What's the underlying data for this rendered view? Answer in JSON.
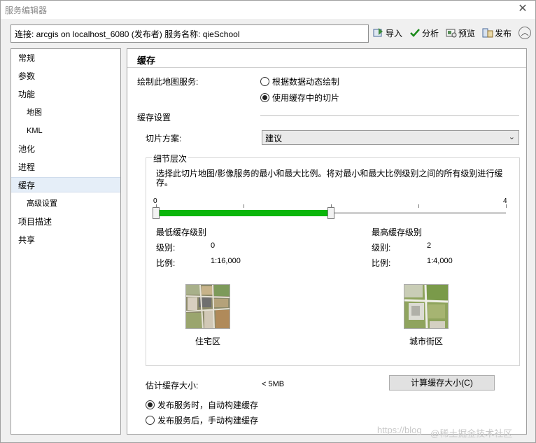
{
  "window": {
    "title": "服务编辑器",
    "close": "✕"
  },
  "connection": {
    "text": "连接: arcgis on localhost_6080 (发布者)    服务名称: qieSchool"
  },
  "toolbar": {
    "import_label": "导入",
    "import_icon": "import-icon",
    "analyze_label": "分析",
    "analyze_icon": "checkmark-icon",
    "preview_label": "预览",
    "preview_icon": "preview-icon",
    "publish_label": "发布",
    "publish_icon": "publish-icon",
    "collapse": "︿"
  },
  "sidebar": {
    "items": [
      {
        "label": "常规"
      },
      {
        "label": "参数"
      },
      {
        "label": "功能"
      },
      {
        "label": "地图"
      },
      {
        "label": "KML"
      },
      {
        "label": "池化"
      },
      {
        "label": "进程"
      },
      {
        "label": "缓存"
      },
      {
        "label": "高级设置"
      },
      {
        "label": "项目描述"
      },
      {
        "label": "共享"
      }
    ],
    "active": "缓存"
  },
  "main": {
    "title": "缓存",
    "draw_label": "绘制此地图服务:",
    "radio_dynamic": "根据数据动态绘制",
    "radio_cache": "使用缓存中的切片",
    "cache_settings": "缓存设置",
    "tiling_label": "切片方案:",
    "tiling_value": "建议",
    "lod_title": "细节层次",
    "lod_desc": "选择此切片地图/影像服务的最小和最大比例。将对最小和最大比例级别之间的所有级别进行缓存。",
    "slider": {
      "min_tick": "0",
      "max_tick": "4",
      "low_level": 0,
      "high_level": 2,
      "max_level": 4
    },
    "min_title": "最低缓存级别",
    "max_title": "最高缓存级别",
    "level_label": "级别:",
    "scale_label": "比例:",
    "min_level": "0",
    "min_scale": "1:16,000",
    "max_level": "2",
    "max_scale": "1:4,000",
    "min_caption": "住宅区",
    "max_caption": "城市街区",
    "estimate_label": "估计缓存大小:",
    "estimate_value": "< 5MB",
    "compute_button": "计算缓存大小(C)",
    "auto_build": "发布服务时，自动构建缓存",
    "manual_build": "发布服务后，手动构建缓存"
  },
  "watermark": {
    "left": "https://blog",
    "right": "@稀土掘金技术社区"
  },
  "colors": {
    "accent_green": "#0ab60a",
    "selection": "#e5eef8"
  }
}
